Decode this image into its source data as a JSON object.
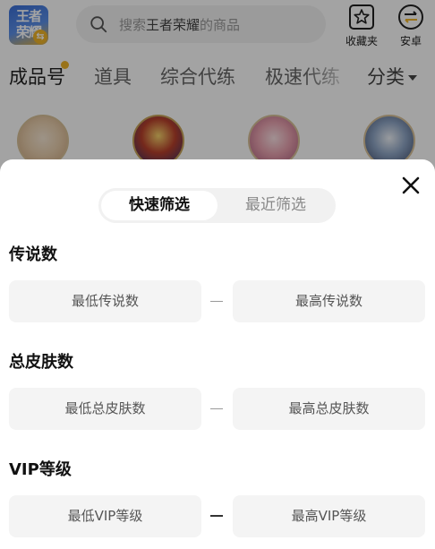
{
  "app": {
    "logo_text": "王者荣耀",
    "search": {
      "prefix": "搜索",
      "keyword": "王者荣耀",
      "suffix": "的商品"
    },
    "actions": [
      {
        "label": "收藏夹",
        "icon": "star-icon"
      },
      {
        "label": "安卓",
        "icon": "android-exchange-icon"
      }
    ]
  },
  "categories": {
    "tabs": [
      "成品号",
      "道具",
      "综合代练",
      "极速代练"
    ],
    "more_label": "分类",
    "accent": "#f0b429"
  },
  "filter_sheet": {
    "tabs": {
      "active": "快速筛选",
      "inactive": "最近筛选"
    },
    "sections": [
      {
        "title": "传说数",
        "min_placeholder": "最低传说数",
        "max_placeholder": "最高传说数"
      },
      {
        "title": "总皮肤数",
        "min_placeholder": "最低总皮肤数",
        "max_placeholder": "最高总皮肤数"
      },
      {
        "title": "VIP等级",
        "min_placeholder": "最低VIP等级",
        "max_placeholder": "最高VIP等级"
      }
    ]
  }
}
